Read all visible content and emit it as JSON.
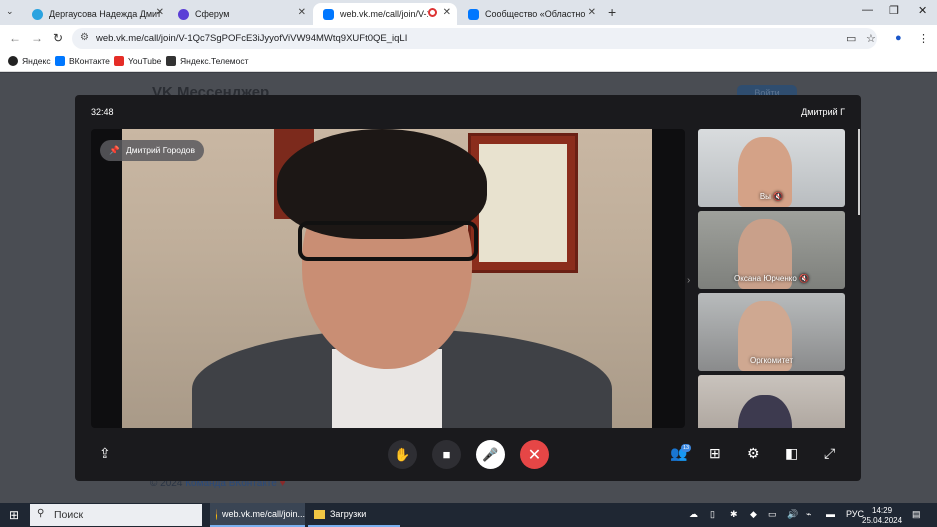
{
  "browser": {
    "tabs": [
      {
        "label": "Дергаусова Надежда Дмит",
        "icon": "telegram-icon",
        "color": "#2aa3e0"
      },
      {
        "label": "Сферум",
        "icon": "sferum-icon",
        "color": "#5b3fd6"
      },
      {
        "label": "web.vk.me/call/join/V-1Q",
        "icon": "vk-icon",
        "color": "#0077ff"
      },
      {
        "label": "Сообщество «Областной Дв",
        "icon": "vk-icon",
        "color": "#0077ff"
      }
    ],
    "url": "web.vk.me/call/join/V-1Qc7SgPOFcE3iJyyofViVW94MWtq9XUFt0QE_iqLI",
    "bookmarks": [
      "Яндекс",
      "ВКонтакте",
      "YouTube",
      "Яндекс.Телемост"
    ]
  },
  "page_behind": {
    "logo": "VK Мессенджер",
    "login_button": "Войти",
    "footer_prefix": "© 2024",
    "footer_link": "Команда ВКонтакте"
  },
  "call": {
    "timer": "32:48",
    "caller_name": "Дмитрий Г",
    "pinned_speaker": "Дмитрий Городов",
    "participants": [
      {
        "label": "Вы",
        "muted": true
      },
      {
        "label": "Оксана Юрченко",
        "muted": true
      },
      {
        "label": "Оргкомитет",
        "muted": false
      },
      {
        "label": "",
        "muted": false
      }
    ],
    "participants_count": "13"
  },
  "taskbar": {
    "search_placeholder": "Поиск",
    "apps": [
      "web.vk.me/call/join...",
      "Загрузки"
    ],
    "language": "РУС",
    "time": "14:29",
    "date": "25.04.2024"
  },
  "colors": {
    "accent": "#0077ff",
    "end_call": "#e64646"
  }
}
